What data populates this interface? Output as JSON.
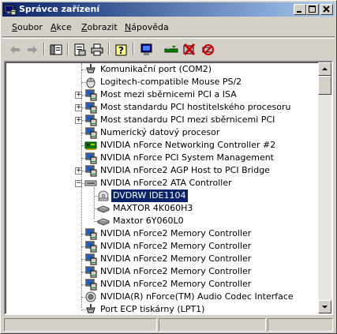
{
  "window": {
    "title": "Správce zařízení",
    "title_icon": "device-manager-icon",
    "controls": [
      "minimize",
      "maximize",
      "close"
    ],
    "titlebar_gradient": [
      "#0a246a",
      "#a6caf0"
    ]
  },
  "menu": [
    {
      "label": "Soubor",
      "accel": "S",
      "rest": "oubor"
    },
    {
      "label": "Akce",
      "accel": "A",
      "rest": "kce"
    },
    {
      "label": "Zobrazit",
      "accel": "Z",
      "rest": "obrazit"
    },
    {
      "label": "Nápověda",
      "accel": "N",
      "rest": "ápověda"
    }
  ],
  "toolbar": [
    {
      "icon": "back-arrow-icon"
    },
    {
      "icon": "forward-arrow-icon"
    },
    {
      "icon": "show-hide-tree-icon"
    },
    {
      "icon": "properties-icon"
    },
    {
      "icon": "print-icon"
    },
    {
      "icon": "help-icon"
    },
    {
      "icon": "scan-hardware-icon"
    },
    {
      "icon": "update-driver-icon"
    },
    {
      "icon": "uninstall-icon"
    },
    {
      "icon": "disable-icon"
    }
  ],
  "tree": {
    "items": [
      {
        "label": "Komunikační port (COM2)",
        "icon": "port-icon",
        "level": 1,
        "expander": ""
      },
      {
        "label": "Logitech-compatible Mouse PS/2",
        "icon": "mouse-icon",
        "level": 1,
        "expander": ""
      },
      {
        "label": "Most mezi sběrnicemi PCI a ISA",
        "icon": "system-device-icon",
        "level": 1,
        "expander": "+"
      },
      {
        "label": "Most standardu PCI hostitelského procesoru",
        "icon": "system-device-icon",
        "level": 1,
        "expander": "+"
      },
      {
        "label": "Most standardu PCI mezi sběrnicemi PCI",
        "icon": "system-device-icon",
        "level": 1,
        "expander": "+"
      },
      {
        "label": "Numerický datový procesor",
        "icon": "system-device-icon",
        "level": 1,
        "expander": ""
      },
      {
        "label": "NVIDIA nForce Networking Controller #2",
        "icon": "network-card-icon",
        "level": 1,
        "expander": ""
      },
      {
        "label": "NVIDIA nForce PCI System Management",
        "icon": "system-device-icon",
        "level": 1,
        "expander": ""
      },
      {
        "label": "NVIDIA nForce2 AGP Host to PCI Bridge",
        "icon": "system-device-icon",
        "level": 1,
        "expander": "+"
      },
      {
        "label": "NVIDIA nForce2 ATA Controller",
        "icon": "ide-controller-icon",
        "level": 1,
        "expander": "-"
      },
      {
        "label": "DVDRW IDE1104",
        "icon": "dvd-drive-icon",
        "level": 2,
        "expander": "",
        "selected": true
      },
      {
        "label": "MAXTOR 4K060H3",
        "icon": "hard-disk-icon",
        "level": 2,
        "expander": ""
      },
      {
        "label": "Maxtor 6Y060L0",
        "icon": "hard-disk-icon",
        "level": 2,
        "expander": ""
      },
      {
        "label": "NVIDIA nForce2 Memory Controller",
        "icon": "system-device-icon",
        "level": 1,
        "expander": ""
      },
      {
        "label": "NVIDIA nForce2 Memory Controller",
        "icon": "system-device-icon",
        "level": 1,
        "expander": ""
      },
      {
        "label": "NVIDIA nForce2 Memory Controller",
        "icon": "system-device-icon",
        "level": 1,
        "expander": ""
      },
      {
        "label": "NVIDIA nForce2 Memory Controller",
        "icon": "system-device-icon",
        "level": 1,
        "expander": ""
      },
      {
        "label": "NVIDIA nForce2 Memory Controller",
        "icon": "system-device-icon",
        "level": 1,
        "expander": ""
      },
      {
        "label": "NVIDIA(R) nForce(TM) Audio Codec Interface",
        "icon": "audio-icon",
        "level": 1,
        "expander": ""
      },
      {
        "label": "Port ECP tiskárny (LPT1)",
        "icon": "port-icon",
        "level": 1,
        "expander": ""
      }
    ]
  },
  "colors": {
    "selection": "#0a246a",
    "face": "#d4d0c8"
  }
}
